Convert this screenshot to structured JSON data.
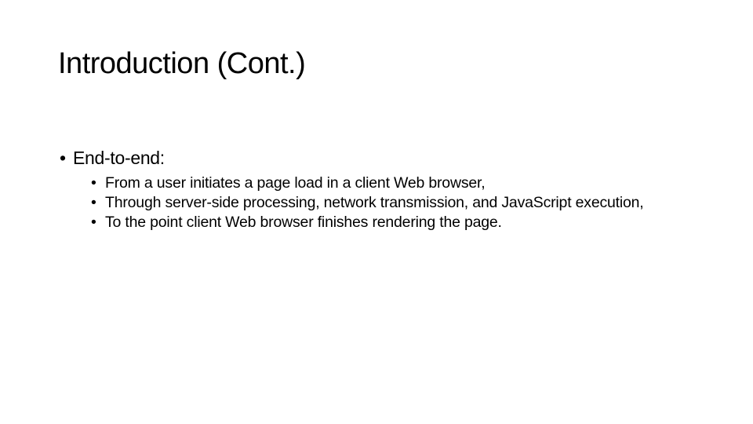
{
  "slide": {
    "title": "Introduction (Cont.)",
    "bullets": [
      {
        "label": "End-to-end:",
        "subitems": [
          "From a user initiates a page load in a client Web browser,",
          "Through server-side processing, network transmission, and JavaScript execution,",
          "To the point client Web browser finishes rendering the page."
        ]
      }
    ],
    "bullet_glyph": "•"
  }
}
